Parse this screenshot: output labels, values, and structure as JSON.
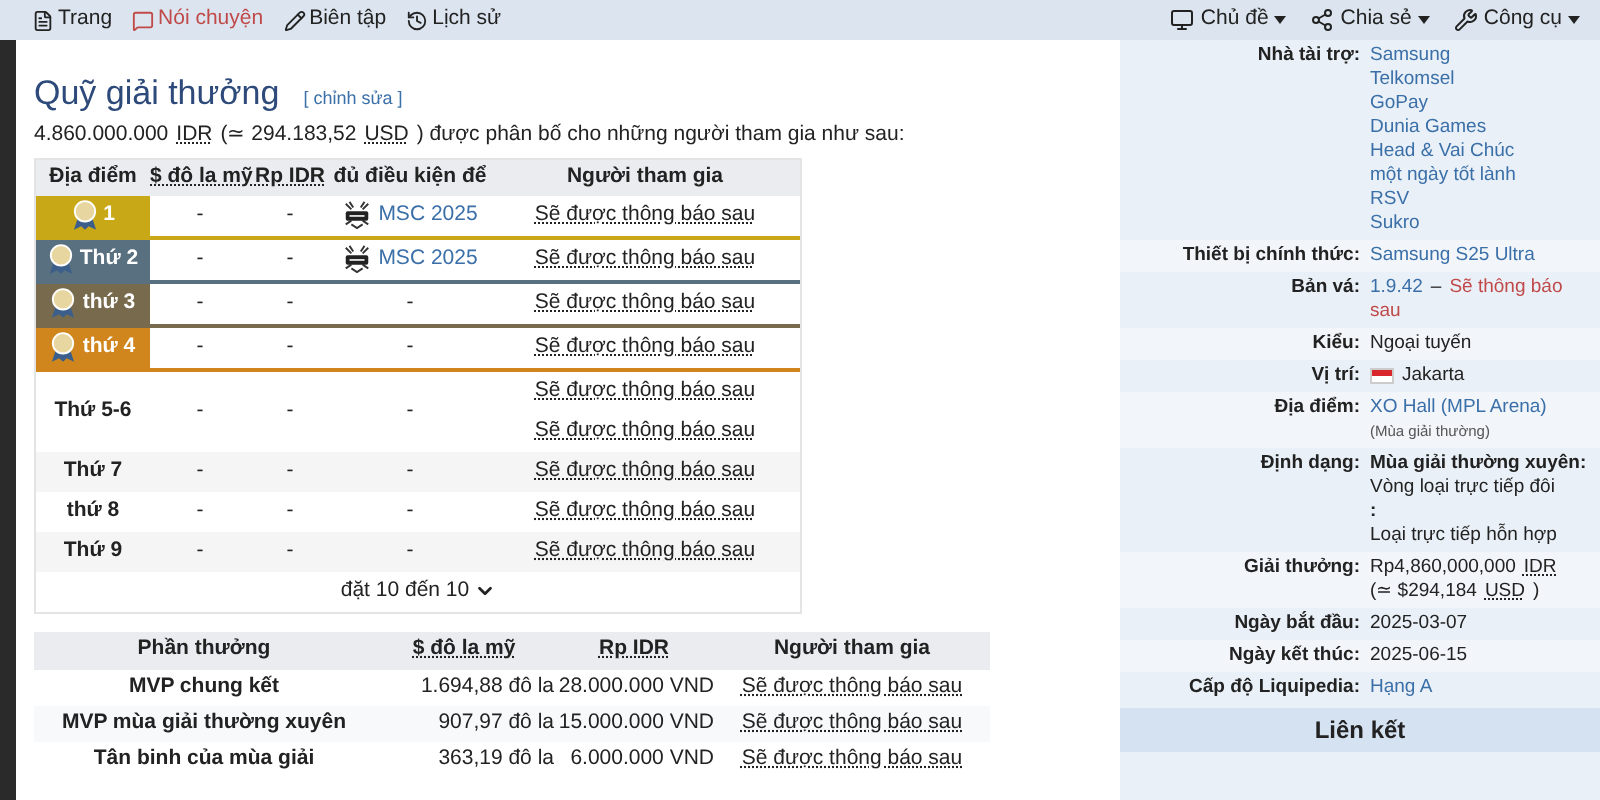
{
  "nav": {
    "left": [
      {
        "label": "Trang",
        "kind": "page",
        "highlighted": false
      },
      {
        "label": "Nói chuyện",
        "kind": "chat",
        "highlighted": true
      },
      {
        "label": "Biên tập",
        "kind": "pencil",
        "highlighted": false
      },
      {
        "label": "Lịch sử",
        "kind": "history",
        "highlighted": false
      }
    ],
    "right": [
      {
        "label": "Chủ đề",
        "kind": "monitor"
      },
      {
        "label": "Chia sẻ",
        "kind": "share"
      },
      {
        "label": "Công cụ",
        "kind": "wrench"
      }
    ]
  },
  "prize_pool": {
    "title": "Quỹ giải thưởng",
    "edit_link": "[ chỉnh sửa ]",
    "summary": [
      {
        "text": "4.860.000.000",
        "abbr": false
      },
      {
        "text": "IDR",
        "abbr": true
      },
      {
        "text": "(≃ 294.183,52",
        "abbr": false
      },
      {
        "text": "USD",
        "abbr": true
      },
      {
        "text": ") được phân bố cho những người tham gia như sau:",
        "abbr": false
      }
    ],
    "columns": [
      {
        "label": "Địa điểm",
        "abbr": false
      },
      {
        "label": "$ đô la mỹ",
        "abbr": true
      },
      {
        "label": "Rp IDR",
        "abbr": true
      },
      {
        "label": "đủ điều kiện để",
        "abbr": false
      },
      {
        "label": "Người tham gia",
        "abbr": false
      }
    ],
    "rows": [
      {
        "place": "1",
        "medal": true,
        "color": "#c9a818",
        "usd": "-",
        "idr": "-",
        "qualifies": "MSC 2025",
        "qualifies_logo": true,
        "participants": [
          "Sẽ được thông báo sau"
        ]
      },
      {
        "place": "Thứ 2",
        "medal": true,
        "color": "#587080",
        "usd": "-",
        "idr": "-",
        "qualifies": "MSC 2025",
        "qualifies_logo": true,
        "participants": [
          "Sẽ được thông báo sau"
        ]
      },
      {
        "place": "thứ 3",
        "medal": true,
        "color": "#786a4c",
        "usd": "-",
        "idr": "-",
        "qualifies": "-",
        "qualifies_logo": false,
        "participants": [
          "Sẽ được thông báo sau"
        ]
      },
      {
        "place": "thứ 4",
        "medal": true,
        "color": "#d0861c",
        "usd": "-",
        "idr": "-",
        "qualifies": "-",
        "qualifies_logo": false,
        "participants": [
          "Sẽ được thông báo sau"
        ]
      },
      {
        "place": "Thứ 5-6",
        "medal": false,
        "color": "#ffffff",
        "usd": "-",
        "idr": "-",
        "qualifies": "-",
        "qualifies_logo": false,
        "participants": [
          "Sẽ được thông báo sau",
          "Sẽ được thông báo sau"
        ]
      },
      {
        "place": "Thứ 7",
        "medal": false,
        "color": "#f5f5f5",
        "usd": "-",
        "idr": "-",
        "qualifies": "-",
        "qualifies_logo": false,
        "participants": [
          "Sẽ được thông báo sau"
        ]
      },
      {
        "place": "thứ 8",
        "medal": false,
        "color": "#ffffff",
        "usd": "-",
        "idr": "-",
        "qualifies": "-",
        "qualifies_logo": false,
        "participants": [
          "Sẽ được thông báo sau"
        ]
      },
      {
        "place": "Thứ 9",
        "medal": false,
        "color": "#f5f5f5",
        "usd": "-",
        "idr": "-",
        "qualifies": "-",
        "qualifies_logo": false,
        "participants": [
          "Sẽ được thông báo sau"
        ]
      }
    ],
    "footer": "đặt 10 đến 10"
  },
  "awards": {
    "columns": [
      {
        "label": "Phần thưởng",
        "abbr": false
      },
      {
        "label": "$ đô la mỹ",
        "abbr": true
      },
      {
        "label": "Rp IDR",
        "abbr": true
      },
      {
        "label": "Người tham gia",
        "abbr": false
      }
    ],
    "rows": [
      {
        "award": "MVP chung kết",
        "usd": "1.694,88 đô la",
        "idr": "28.000.000 VND",
        "participant": "Sẽ được thông báo sau"
      },
      {
        "award": "MVP mùa giải thường xuyên",
        "usd": "907,97 đô la",
        "idr": "15.000.000 VND",
        "participant": "Sẽ được thông báo sau"
      },
      {
        "award": "Tân binh của mùa giải",
        "usd": "363,19 đô la",
        "idr": "6.000.000 VND",
        "participant": "Sẽ được thông báo sau"
      }
    ]
  },
  "infobox": {
    "rows": [
      {
        "label": "Nhà tài trợ:",
        "lines": [
          [
            {
              "text": "Samsung",
              "kind": "link"
            }
          ],
          [
            {
              "text": "Telkomsel",
              "kind": "link"
            }
          ],
          [
            {
              "text": "GoPay",
              "kind": "link"
            }
          ],
          [
            {
              "text": "Dunia Games",
              "kind": "link"
            }
          ],
          [
            {
              "text": "Head & Vai Chúc",
              "kind": "link"
            }
          ],
          [
            {
              "text": "một ngày tốt lành",
              "kind": "link"
            }
          ],
          [
            {
              "text": "RSV",
              "kind": "link"
            }
          ],
          [
            {
              "text": "Sukro",
              "kind": "link"
            }
          ]
        ]
      },
      {
        "label": "Thiết bị chính thức:",
        "lines": [
          [
            {
              "text": "Samsung S25 Ultra",
              "kind": "link"
            }
          ]
        ]
      },
      {
        "label": "Bản vá:",
        "lines": [
          [
            {
              "text": "1.9.42",
              "kind": "link"
            },
            {
              "text": "–",
              "kind": "text"
            },
            {
              "text": "Sẽ thông báo",
              "kind": "red"
            }
          ],
          [
            {
              "text": "sau",
              "kind": "red"
            }
          ]
        ]
      },
      {
        "label": "Kiểu:",
        "lines": [
          [
            {
              "text": "Ngoại tuyến",
              "kind": "text"
            }
          ]
        ]
      },
      {
        "label": "Vị trí:",
        "lines": [
          [
            {
              "kind": "flag"
            },
            {
              "text": "Jakarta",
              "kind": "text"
            }
          ]
        ]
      },
      {
        "label": "Địa điểm:",
        "lines": [
          [
            {
              "text": "XO Hall (MPL Arena)",
              "kind": "link"
            }
          ],
          [
            {
              "text": "(Mùa giải thường)",
              "kind": "small"
            }
          ]
        ]
      },
      {
        "label": "Định dạng:",
        "lines": [
          [
            {
              "text": "Mùa giải thường xuyên:",
              "kind": "bold"
            }
          ],
          [
            {
              "text": "Vòng loại trực tiếp đôi",
              "kind": "text"
            }
          ],
          [
            {
              "text": ":",
              "kind": "bold"
            }
          ],
          [
            {
              "text": "Loại trực tiếp hỗn hợp",
              "kind": "text"
            }
          ]
        ]
      },
      {
        "label": "Giải thưởng:",
        "lines": [
          [
            {
              "text": "Rp4,860,000,000",
              "kind": "text"
            },
            {
              "text": "IDR",
              "kind": "abbr"
            }
          ],
          [
            {
              "text": "(≃ $294,184",
              "kind": "text"
            },
            {
              "text": "USD",
              "kind": "abbr"
            },
            {
              "text": ")",
              "kind": "text"
            }
          ]
        ]
      },
      {
        "label": "Ngày bắt đầu:",
        "lines": [
          [
            {
              "text": "2025-03-07",
              "kind": "text"
            }
          ]
        ]
      },
      {
        "label": "Ngày kết thúc:",
        "lines": [
          [
            {
              "text": "2025-06-15",
              "kind": "text"
            }
          ]
        ]
      },
      {
        "label": "Cấp độ Liquipedia:",
        "lines": [
          [
            {
              "text": "Hạng A",
              "kind": "link"
            }
          ]
        ]
      }
    ],
    "section": "Liên kết"
  }
}
